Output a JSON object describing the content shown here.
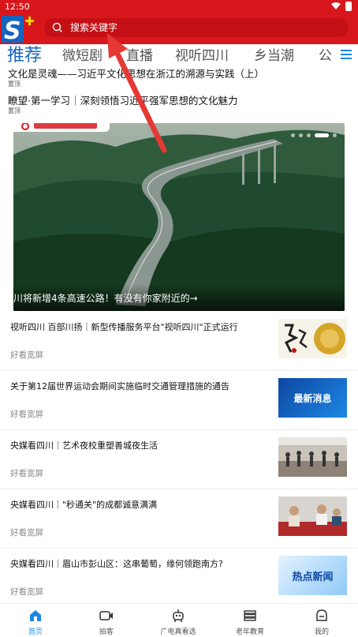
{
  "status_bar": {
    "time": "12:50"
  },
  "header": {
    "logo_text": "S",
    "search": {
      "placeholder": "搜索关键字"
    }
  },
  "tabs": [
    {
      "label": "推荐",
      "active": true
    },
    {
      "label": "微短剧",
      "active": false
    },
    {
      "label": "直播",
      "active": false
    },
    {
      "label": "视听四川",
      "active": false
    },
    {
      "label": "乡当潮",
      "active": false
    },
    {
      "label": "公",
      "active": false
    }
  ],
  "pinned": [
    {
      "title": "文化是灵魂——习近平文化思想在浙江的溯源与实践（上）",
      "tag": "置顶"
    },
    {
      "title": "瞭望·第一学习｜深刻领悟习近平强军思想的文化魅力",
      "tag": "置顶"
    }
  ],
  "banner": {
    "caption": "川将新增4条高速公路！有没有你家附近的→",
    "slide_count": 5,
    "active_slide": 4
  },
  "news": [
    {
      "title": "视听四川 百部川扬｜新型传播服务平台\"视听四川\"正式运行",
      "source": "好看宽屏",
      "thumb": "calligraphy-thumb"
    },
    {
      "title": "关于第12届世界运动会期间实施临时交通管理措施的通告",
      "source": "好看宽屏",
      "thumb": "latest-news-thumb",
      "thumb_text": "最新消息"
    },
    {
      "title": "央媒看四川｜艺术夜校重塑善城夜生活",
      "source": "好看宽屏",
      "thumb": "dance-class-thumb"
    },
    {
      "title": "央媒看四川｜\"秒通关\"的成都诚意满满",
      "source": "好看宽屏",
      "thumb": "customs-thumb"
    },
    {
      "title": "央媒看四川｜眉山市彭山区：这串葡萄，缘何领跑南方?",
      "source": "好看宽屏",
      "thumb": "hot-news-thumb",
      "thumb_text": "热点新闻"
    }
  ],
  "bottom_nav": [
    {
      "label": "首页",
      "icon": "home-icon",
      "active": true
    },
    {
      "label": "拍客",
      "icon": "video-icon",
      "active": false
    },
    {
      "label": "广电真看选",
      "icon": "robot-icon",
      "active": false
    },
    {
      "label": "老年教育",
      "icon": "books-icon",
      "active": false
    },
    {
      "label": "我的",
      "icon": "profile-icon",
      "active": false
    }
  ],
  "colors": {
    "brand_red": "#d8171d",
    "accent_blue": "#1e88e5"
  }
}
